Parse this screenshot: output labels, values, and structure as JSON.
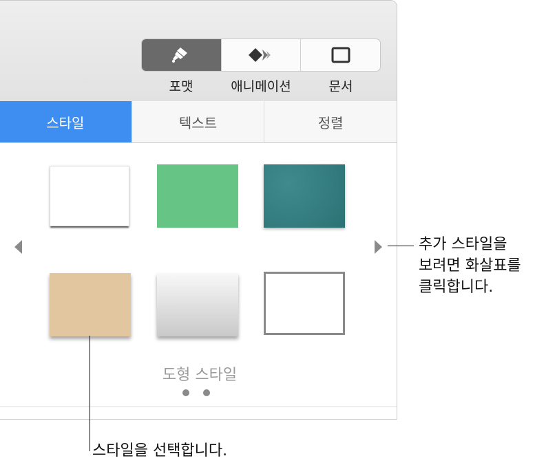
{
  "toolbar": {
    "segments": [
      {
        "label": "포맷",
        "icon": "paintbrush-icon",
        "active": true
      },
      {
        "label": "애니메이션",
        "icon": "diamond-animation-icon",
        "active": false
      },
      {
        "label": "문서",
        "icon": "document-icon",
        "active": false
      }
    ]
  },
  "tabs": [
    {
      "label": "스타일",
      "active": true
    },
    {
      "label": "텍스트",
      "active": false
    },
    {
      "label": "정렬",
      "active": false
    }
  ],
  "styles": {
    "swatches": [
      {
        "name": "paper-white",
        "color": "#ffffff"
      },
      {
        "name": "green",
        "color": "#66c484"
      },
      {
        "name": "teal-texture",
        "color": "#2f7679"
      },
      {
        "name": "tan",
        "color": "#e2c6a0"
      },
      {
        "name": "gray-gradient",
        "color": "#d8d8d8"
      },
      {
        "name": "outline",
        "color": "#8a8a8a"
      }
    ],
    "group_label": "도형 스타일",
    "page_count": 2
  },
  "callouts": {
    "arrows_line1": "추가 스타일을",
    "arrows_line2": "보려면 화살표를",
    "arrows_line3": "클릭합니다.",
    "select": "스타일을 선택합니다."
  },
  "colors": {
    "accent": "#3d8ef0",
    "active_segment": "#6a6a6a"
  }
}
